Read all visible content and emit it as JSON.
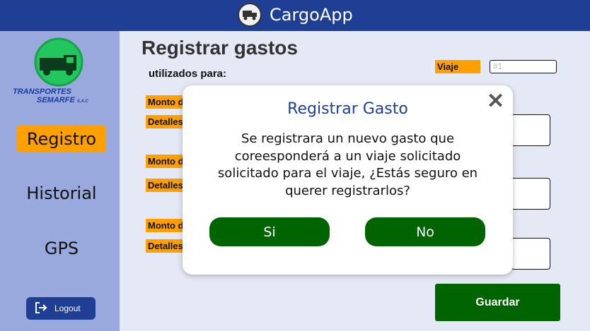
{
  "header": {
    "app_title": "CargoApp",
    "logo_icon": "truck-icon"
  },
  "sidebar": {
    "brand": {
      "line1": "TRANSPORTES",
      "line2": "SEMARFE",
      "suffix": "S.A.C"
    },
    "nav": [
      {
        "label": "Registro",
        "active": true
      },
      {
        "label": "Historial",
        "active": false
      },
      {
        "label": "GPS",
        "active": false
      }
    ],
    "logout_label": "Logout"
  },
  "main": {
    "title": "Registrar gastos",
    "subtitle": "utilizados para:",
    "trip": {
      "label": "Viaje",
      "placeholder": "#1"
    },
    "expense_rows": [
      {
        "amount_label": "Monto d",
        "details_label": "Detalles"
      },
      {
        "amount_label": "Monto d",
        "details_label": "Detalles"
      },
      {
        "amount_label": "Monto d",
        "details_label": "Detalles"
      }
    ],
    "save_label": "Guardar"
  },
  "modal": {
    "title": "Registrar Gasto",
    "message": "Se registrara un nuevo gasto que coreesponderá a un viaje solicitado solicitado para el viaje, ¿Estás seguro en querer registrarlos?",
    "close_glyph": "✕",
    "yes_label": "Si",
    "no_label": "No"
  },
  "colors": {
    "header": "#1e3f94",
    "sidebar": "#99a9dd",
    "accent": "#ff9f00",
    "button_green": "#006400",
    "background": "#e5e9f5"
  }
}
